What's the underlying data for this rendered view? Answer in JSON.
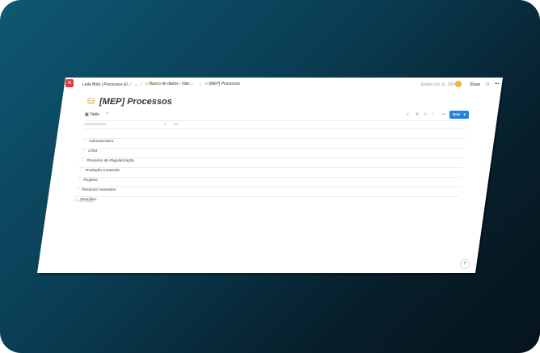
{
  "breadcrumbs": [
    {
      "label": "Leila Brito | Processos Et..."
    },
    {
      "label": "..."
    },
    {
      "label": "Banco de dados - Não ..."
    },
    {
      "label": "[MEP] Processos"
    }
  ],
  "topbar": {
    "edited": "Edited Oct 11, 2024",
    "share_label": "Share",
    "more_label": "•••"
  },
  "page": {
    "title": "[MEP] Processos"
  },
  "view": {
    "tab_label": "Table",
    "add_label": "+",
    "new_label": "New",
    "column_header": "Processo",
    "add_column": "+",
    "column_more": "•••"
  },
  "rows": [
    {
      "label": "Administrativo"
    },
    {
      "label": "CRM"
    },
    {
      "label": "Processo de Regularização"
    },
    {
      "label": "Produção Conteúdo"
    },
    {
      "label": "Projetos"
    },
    {
      "label": "Recursos Humanos"
    },
    {
      "label": "Reuniões"
    }
  ],
  "new_page_label": "New page",
  "help_label": "?",
  "colors": {
    "accent": "#2383e2",
    "logo": "#e3363e",
    "background_dark": "#06141c",
    "background_teal": "#0f5873"
  }
}
